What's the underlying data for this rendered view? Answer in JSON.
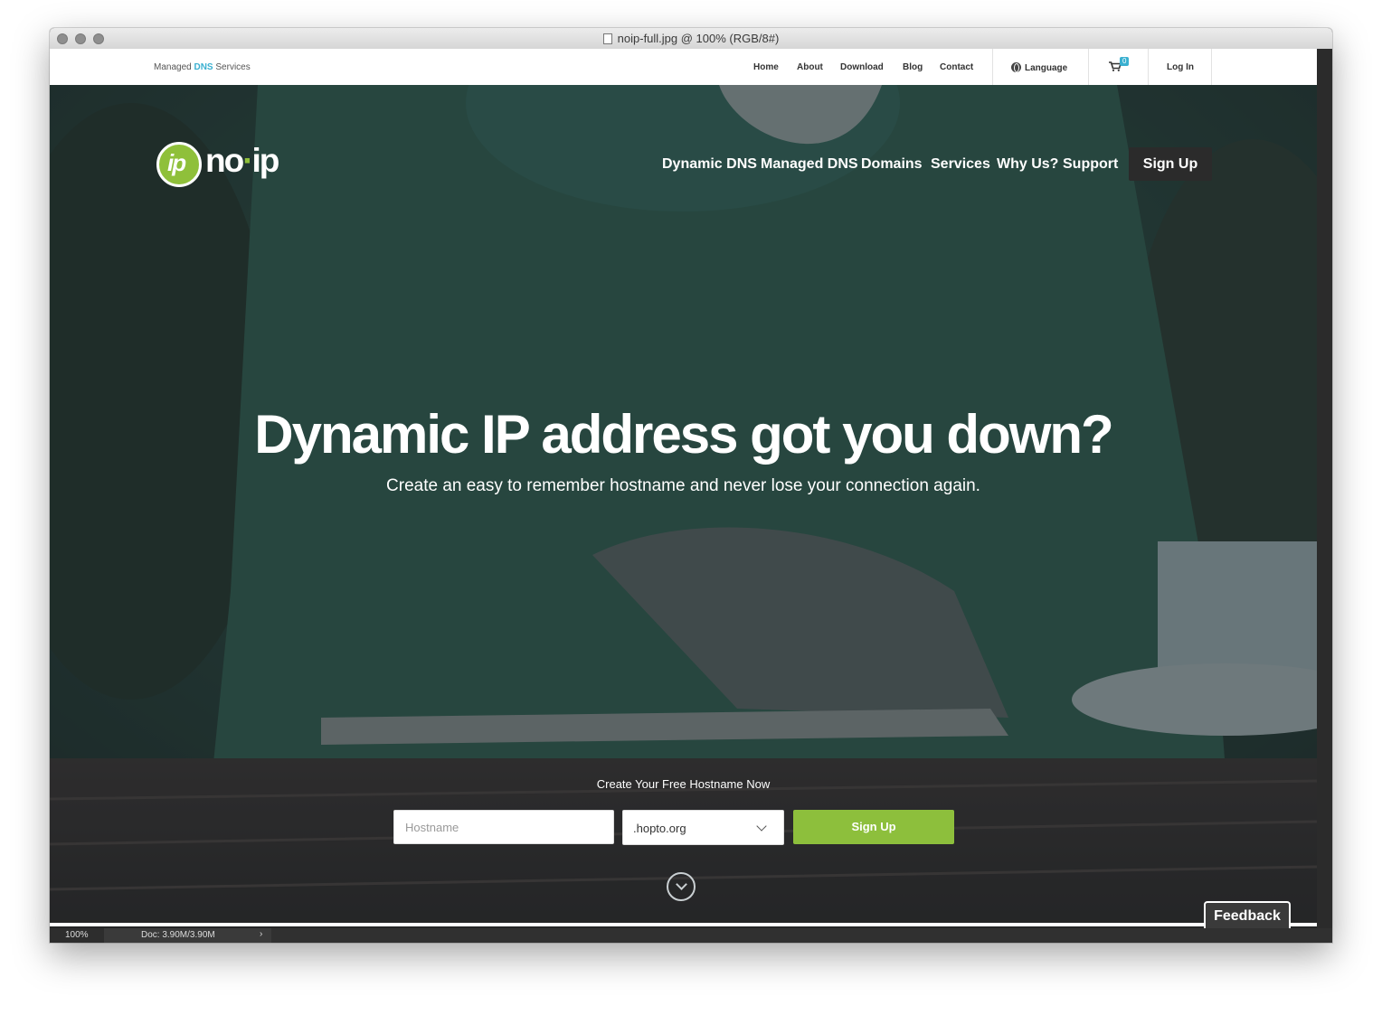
{
  "window": {
    "title": "noip-full.jpg @ 100% (RGB/8#)"
  },
  "topbar": {
    "brand_prefix": "Managed",
    "brand_highlight": "DNS",
    "brand_suffix": "Services",
    "links": [
      "Home",
      "About",
      "Download",
      "Blog",
      "Contact"
    ],
    "language_label": "Language",
    "cart_count": "0",
    "login_label": "Log In"
  },
  "logo": {
    "mark_text": "ip",
    "word_a": "no",
    "word_dot": "·",
    "word_b": "ip"
  },
  "mainnav": {
    "items": [
      "Dynamic DNS",
      "Managed DNS",
      "Domains",
      "Services",
      "Why Us?",
      "Support"
    ],
    "signup_label": "Sign Up"
  },
  "hero": {
    "headline": "Dynamic IP address got you down?",
    "subhead": "Create an easy to remember hostname and never lose your connection again."
  },
  "cta": {
    "label": "Create Your Free Hostname Now",
    "hostname_placeholder": "Hostname",
    "domain_selected": ".hopto.org",
    "signup_label": "Sign Up"
  },
  "feedback_label": "Feedback",
  "statusbar": {
    "zoom": "100%",
    "doc": "Doc: 3.90M/3.90M",
    "arrow": "›"
  },
  "colors": {
    "accent_green": "#8dbf3c",
    "accent_blue": "#3ab0d0",
    "dark_button": "#2b2b2b"
  }
}
